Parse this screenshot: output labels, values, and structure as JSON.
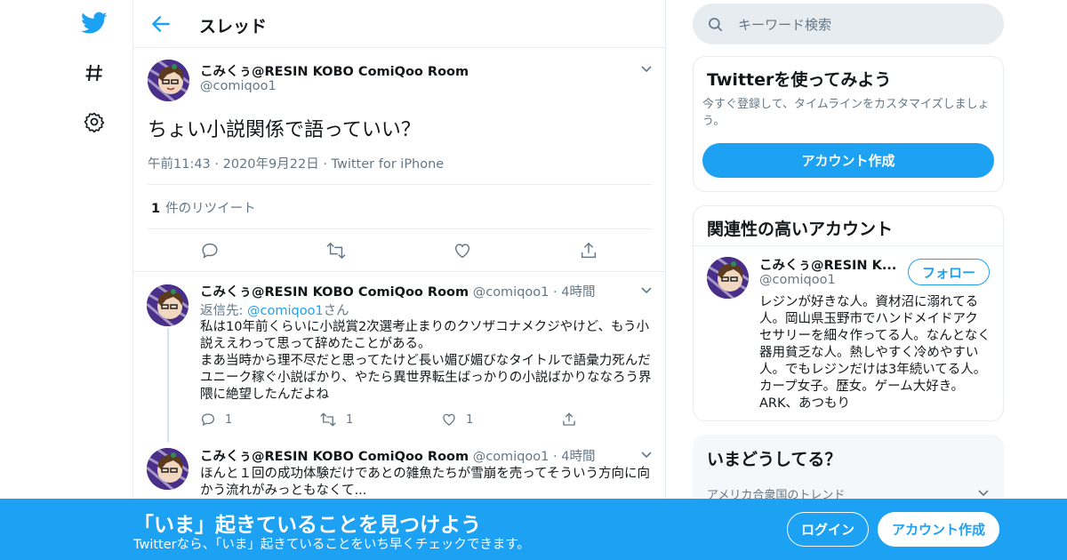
{
  "colors": {
    "accent": "#1da1f2",
    "muted": "#657786",
    "border": "#e6ecf0",
    "text": "#14171a"
  },
  "nav": {
    "icons": [
      "twitter-bird-icon",
      "hashtag-icon",
      "settings-gear-icon"
    ]
  },
  "header": {
    "title": "スレッド"
  },
  "focus_tweet": {
    "name": "こみくぅ@RESIN KOBO ComiQoo Room",
    "handle": "@comiqoo1",
    "text": "ちょい小説関係で語っていい？",
    "time": "午前11:43",
    "date": "2020年9月22日",
    "source": "Twitter for iPhone",
    "retweet_count": "1",
    "retweet_label": "件のリツイート"
  },
  "replies": [
    {
      "name": "こみくぅ@RESIN KOBO ComiQoo Room",
      "handle": "@comiqoo1",
      "time": "4時間",
      "reply_to_prefix": "返信先: ",
      "reply_to_handle": "@comiqoo1",
      "reply_to_suffix": "さん",
      "text": "私は10年前くらいに小説賞2次選考止まりのクソザコナメクジやけど、もう小説ええわって思って辞めたことがある。\nまあ当時から理不尽だと思ってたけど長い媚び媚びなタイトルで語彙力死んだユニーク稼ぐ小説ばかり、やたら異世界転生ばっかりの小説ばかりななろう界隈に絶望したんだよね",
      "reply_count": "1",
      "retweet_count": "1",
      "like_count": "1"
    },
    {
      "name": "こみくぅ@RESIN KOBO ComiQoo Room",
      "handle": "@comiqoo1",
      "time": "4時間",
      "text": "ほんと１回の成功体験だけであとの雑魚たちが雪崩を売ってそういう方向に向かう流れがみっともなくて..."
    }
  ],
  "search": {
    "placeholder": "キーワード検索"
  },
  "signup_card": {
    "title": "Twitterを使ってみよう",
    "description": "今すぐ登録して、タイムラインをカスタマイズしましょう。",
    "button": "アカウント作成"
  },
  "related_card": {
    "title": "関連性の高いアカウント",
    "name": "こみくぅ@RESIN K...",
    "handle": "@comiqoo1",
    "follow_button": "フォロー",
    "bio": "レジンが好きな人。資材沼に溺れてる人。岡山県玉野市でハンドメイドアクセサリーを細々作ってる人。なんとなく器用貧乏な人。熱しやすく冷めやすい人。でもレジンだけは3年続いてる人。カープ女子。歴女。ゲーム大好き。ARK、あつもり"
  },
  "trends_card": {
    "title": "いまどうしてる？",
    "subtitle": "アメリカ合衆国のトレンド"
  },
  "banner": {
    "title": "「いま」起きていることを見つけよう",
    "subtitle": "Twitterなら、「いま」起きていることをいち早くチェックできます。",
    "login": "ログイン",
    "signup": "アカウント作成"
  }
}
